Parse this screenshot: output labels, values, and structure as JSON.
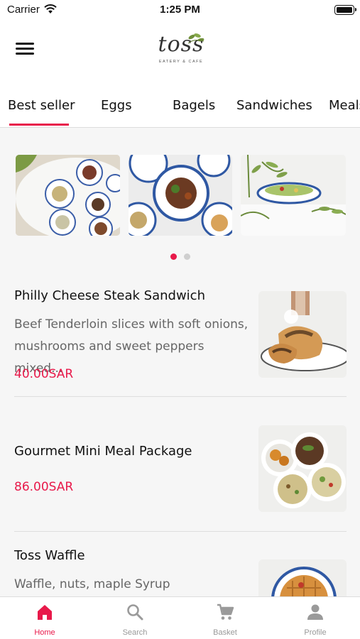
{
  "status_bar": {
    "carrier": "Carrier",
    "time": "1:25 PM"
  },
  "header": {
    "logo_text": "toss",
    "logo_subtitle": "EATERY & CAFE"
  },
  "tabs": [
    {
      "label": "Best seller",
      "active": true
    },
    {
      "label": "Eggs"
    },
    {
      "label": "Bagels"
    },
    {
      "label": "Sandwiches"
    },
    {
      "label": "Meals"
    }
  ],
  "carousel": {
    "slide_count": 2,
    "active_index": 0
  },
  "products": [
    {
      "name": "Philly Cheese Steak Sandwich",
      "description": "Beef Tenderloin slices with soft onions, mushrooms and sweet peppers mixed...",
      "price": "40.00SAR"
    },
    {
      "name": "Gourmet Mini Meal Package",
      "description": "",
      "price": "86.00SAR"
    },
    {
      "name": "Toss Waffle",
      "description": "Waffle, nuts, maple Syrup",
      "price": ""
    }
  ],
  "tab_bar": [
    {
      "label": "Home",
      "icon": "home-icon",
      "active": true
    },
    {
      "label": "Search",
      "icon": "search-icon"
    },
    {
      "label": "Basket",
      "icon": "cart-icon"
    },
    {
      "label": "Profile",
      "icon": "person-icon"
    }
  ],
  "colors": {
    "accent": "#e8194a",
    "inactive": "#999999",
    "background": "#f6f6f6"
  }
}
